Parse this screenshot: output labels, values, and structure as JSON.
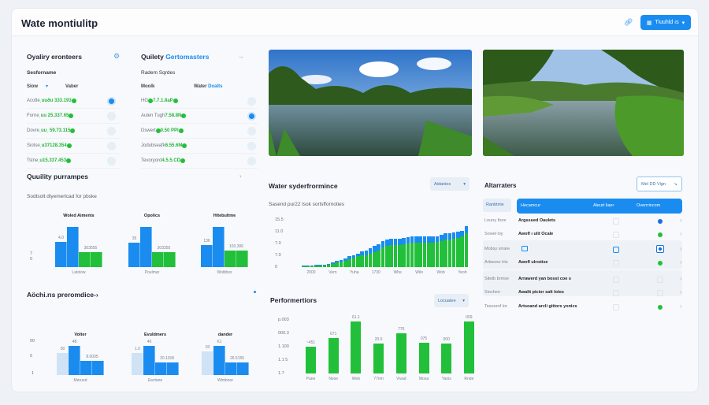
{
  "header": {
    "title": "Wate montiulitp",
    "button_label": "Tiuuhld ıs",
    "accent": "#1a8cf0"
  },
  "table1": {
    "title": "Oyaliry eronteers",
    "subtitle": "Sesforname",
    "col1": "Siow",
    "col2": "Vaber",
    "rows": [
      {
        "name": "Acotle",
        "value": "ˌuuðu 333.193"
      },
      {
        "name": "Forne",
        "value": "ˌuu 25.337.65"
      },
      {
        "name": "Dovre",
        "value": "ˌuuˌ 59.73.115"
      },
      {
        "name": "Siotse",
        "value": "ˌu37128.354"
      },
      {
        "name": "Tstne",
        "value": "ˌu15.337.453"
      }
    ]
  },
  "table2": {
    "title_a": "Quilety",
    "title_b": "Gertomasters",
    "subtitle": "Radem Sqrdes",
    "col1": "Moolk",
    "col2": "Water",
    "col2b": "Doalts",
    "rows": [
      {
        "name": "HG",
        "value": "7.7.1.8aP",
        "dot": true
      },
      {
        "name": "Aulen Tugh",
        "value": "7.58.8N",
        "dot": false
      },
      {
        "name": "Dswert",
        "value": "0.50 PPI",
        "dot": true
      },
      {
        "name": "Jodubseafk",
        "value": "6.55.6M",
        "dot": false
      },
      {
        "name": "Tevoryord",
        "value": "4.5.5.CD",
        "dot": false
      }
    ]
  },
  "quality": {
    "title": "Quuility purrampes",
    "subtitle": "Sodtsolt dlyemerlcad for pbske",
    "yticks": [
      "7",
      "0"
    ],
    "groups": [
      {
        "name": "Woled Aiments",
        "x": "Latolow",
        "values": [
          0.62,
          1,
          0.37,
          0.37
        ],
        "labels": [
          "4.0",
          "",
          "303555",
          ""
        ]
      },
      {
        "name": "Opolics",
        "x": "Poulmar",
        "values": [
          0.6,
          1,
          0.37,
          0.37
        ],
        "labels": [
          "35",
          "",
          "303355",
          ""
        ]
      },
      {
        "name": "Hitebultme",
        "x": "Woltibos",
        "values": [
          0.55,
          1,
          0.42,
          0.42
        ],
        "labels": [
          "136",
          "",
          "103.306",
          ""
        ]
      }
    ]
  },
  "water_perf": {
    "title": "Water syderfrormince",
    "subtitle": "Sasend pur22 lsok sorlsffornoties",
    "select": "Aidanies",
    "chart_data": {
      "type": "bar",
      "stacked": true,
      "yticks": [
        "0",
        "7.0",
        "7.0",
        "11.0",
        "15.5"
      ],
      "ylim": [
        0,
        15.5
      ],
      "xticks": [
        "2000",
        "Vern",
        "Yuha",
        "1730",
        "Whe",
        "Wilo",
        "Wob",
        "Yeoh"
      ],
      "series": [
        {
          "values": [
            0.2,
            0.2,
            0.2,
            0.4,
            0.5,
            0.6,
            0.8,
            1,
            1.5,
            1.5,
            2,
            2.5,
            3,
            3.5,
            3.8,
            4,
            4.5,
            5,
            5.5,
            6.5,
            7,
            7.2,
            7.3,
            7.3,
            7.5,
            7.8,
            8,
            8,
            8,
            8,
            8,
            8,
            8.2,
            8.5,
            9,
            9,
            9.3,
            9.6,
            10,
            11
          ],
          "color": "#22c03a"
        },
        {
          "values": [
            0.3,
            0.3,
            0.3,
            0.3,
            0.3,
            0.3,
            0.3,
            0.5,
            0.5,
            0.8,
            0.8,
            1,
            1,
            1,
            1.3,
            1.5,
            1.8,
            2,
            2,
            2,
            2,
            2,
            2,
            2,
            2,
            2,
            2,
            2,
            2,
            2,
            2,
            2,
            2,
            2,
            2,
            2,
            2,
            2,
            2,
            2.5
          ],
          "color": "#1a8cf0"
        }
      ]
    }
  },
  "alerts": {
    "title": "Altarraters",
    "button": "Mel DD Vign",
    "header": {
      "tag": "Ranbtrrie",
      "c1": "Hecamcur",
      "c2": "Aleurt liaer",
      "c3": "Overrrincom"
    },
    "rows": [
      {
        "a": "Louny Iture",
        "b": "Argssued Oaulets",
        "dot": "#1a6fe0"
      },
      {
        "a": "Sowel loy",
        "b": "Awofl ı ulit Ocale",
        "dot": "#22c03a"
      },
      {
        "a": "Mobsy srrare",
        "b": "",
        "dot": "sel"
      },
      {
        "a": "Arbsono Irts",
        "b": "Awofl ulrıstise",
        "dot": "#22c03a"
      },
      {
        "a": "Sitetb brmse",
        "b": "Arrawerd yan bosst coe s",
        "dot": ""
      },
      {
        "a": "Siochen",
        "b": "Awalit picior salt lotes",
        "dot": ""
      },
      {
        "a": "Tsouorof lor",
        "b": "Artsoand arcli gittors yonics",
        "dot": "#22c03a"
      }
    ]
  },
  "achieve": {
    "title": "Aöchi.rıs preromdice-›",
    "yticks": [
      "00",
      "6",
      "1"
    ],
    "groups": [
      {
        "name": "Volter",
        "x": "Merund",
        "values": [
          0.76,
          1,
          0.49,
          0.49
        ],
        "labels": [
          "00",
          "48",
          "8.0005",
          ""
        ]
      },
      {
        "name": "Evuldmers",
        "x": "Ewrtane",
        "values": [
          0.76,
          1,
          0.42,
          0.42
        ],
        "labels": [
          "1.0",
          "46",
          "20.1158",
          ""
        ]
      },
      {
        "name": "dander",
        "x": "Wimboor",
        "values": [
          0.8,
          1,
          0.42,
          0.42
        ],
        "labels": [
          "03",
          "K1",
          "26.5155",
          ""
        ]
      }
    ]
  },
  "perf": {
    "title": "Performertiors",
    "select": "Locuatee",
    "chart_data": {
      "type": "bar",
      "yticks": [
        "1.7",
        "1.1 5",
        "1.100",
        "000.3",
        "p.003"
      ],
      "ylim": [
        0,
        70
      ],
      "categories": [
        "Pane",
        "Nese",
        "Web",
        "77nm",
        "Vivad",
        "Mosa",
        "Yanis",
        "Rnde"
      ],
      "values": [
        35,
        46,
        67,
        39,
        52,
        40,
        39,
        67
      ],
      "labels": [
        "~451",
        "671",
        "61.1",
        "20.0",
        "776",
        "075",
        "000",
        "009"
      ],
      "color": "#22c03a"
    }
  }
}
